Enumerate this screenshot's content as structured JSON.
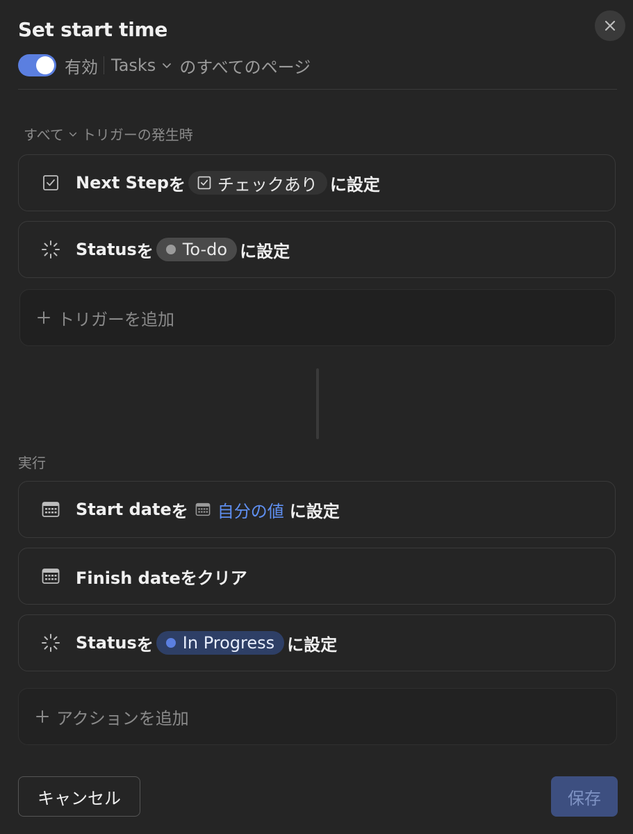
{
  "header": {
    "title": "Set start time",
    "enabled_label": "有効",
    "database_name": "Tasks",
    "scope_suffix": "のすべてのページ",
    "toggle_on": true,
    "close_icon": "close-icon"
  },
  "triggers": {
    "section_mode": "すべて",
    "section_suffix": "トリガーの発生時",
    "items": [
      {
        "icon": "checkbox-icon",
        "property": "Next Step",
        "particle": "を",
        "value_label": "チェックあり",
        "suffix": "に設定"
      },
      {
        "icon": "status-spinner-icon",
        "property": "Status",
        "particle": "を",
        "value_label": "To-do",
        "value_color": "#9b9b9b",
        "suffix": "に設定"
      }
    ],
    "add_label": "トリガーを追加"
  },
  "actions": {
    "section_label": "実行",
    "items": [
      {
        "icon": "calendar-icon",
        "property": "Start date",
        "particle": "を",
        "value_label": "自分の値",
        "suffix": "に設定"
      },
      {
        "icon": "calendar-icon",
        "text": "Finish dateをクリア"
      },
      {
        "icon": "status-spinner-icon",
        "property": "Status",
        "particle": "を",
        "value_label": "In Progress",
        "value_color": "#5b7fe0",
        "suffix": "に設定"
      }
    ],
    "add_label": "アクションを追加"
  },
  "footer": {
    "cancel_label": "キャンセル",
    "save_label": "保存"
  },
  "colors": {
    "background": "#252525",
    "accent": "#5b7fe0",
    "link_blue": "#5f8ff0"
  }
}
